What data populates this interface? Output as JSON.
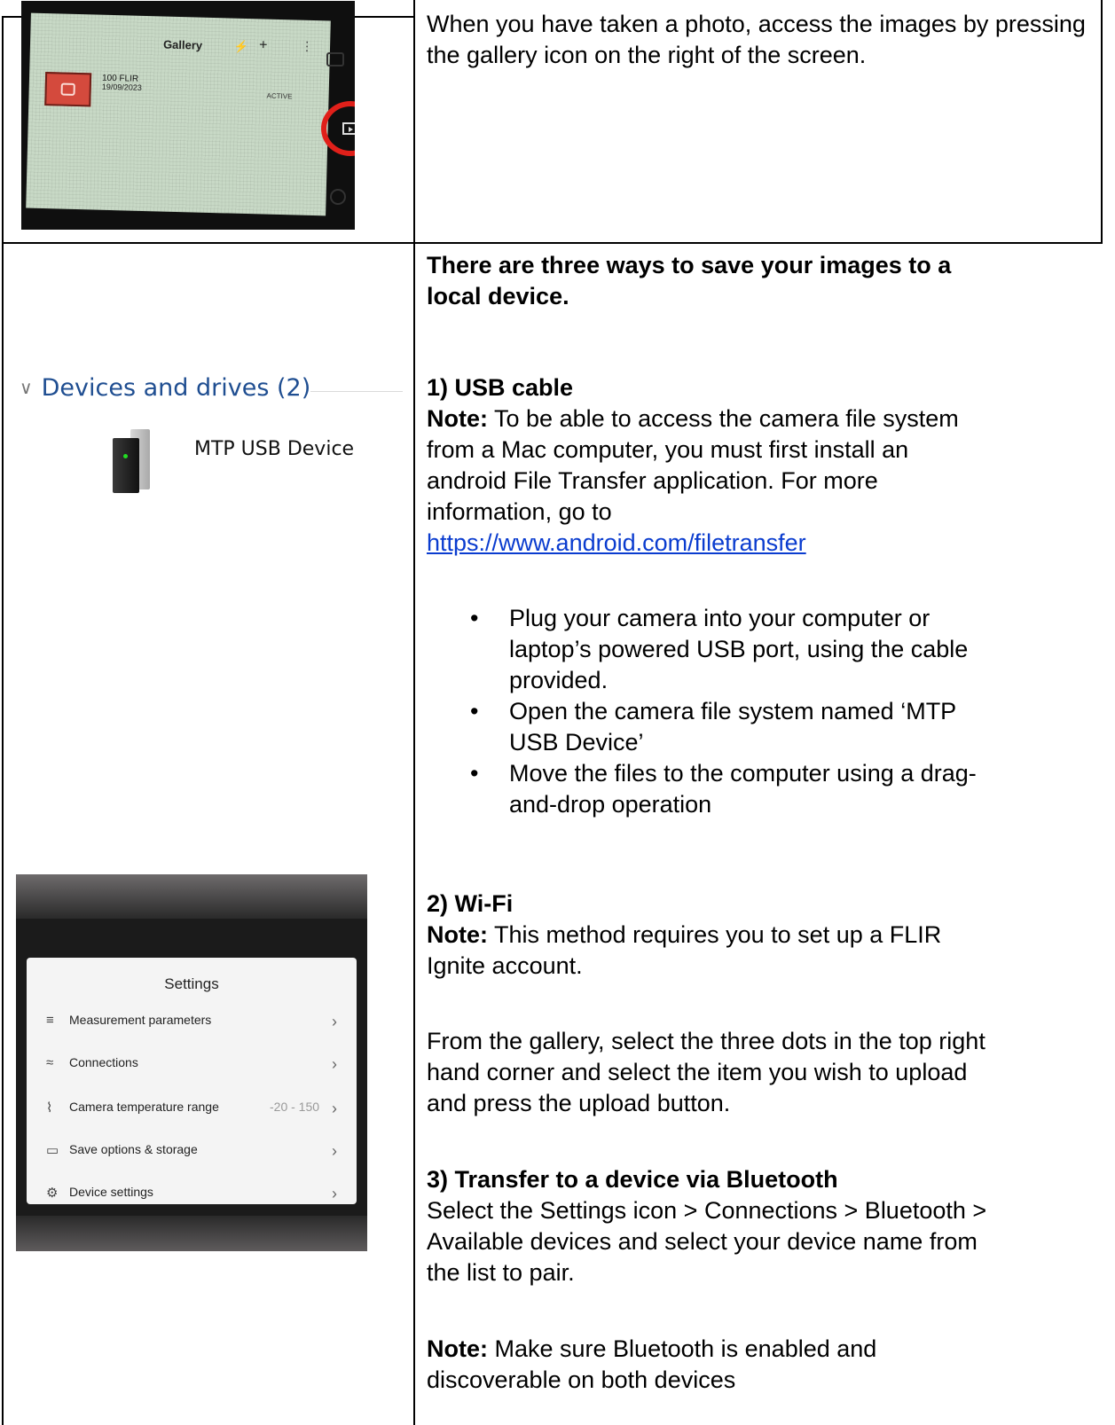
{
  "row1": {
    "intro": "When you have taken a photo, access the images by pressing the gallery icon on the right of the screen."
  },
  "gallery_photo": {
    "title": "Gallery",
    "bolt": "⚡",
    "plus": "+",
    "dots": "⋮",
    "folder_name": "100 FLIR",
    "folder_date": "19/09/2023",
    "status": "ACTIVE"
  },
  "explorer": {
    "chevron": "∨",
    "section_heading": "Devices and drives (2)",
    "drive_name": "MTP USB Device"
  },
  "settings_photo": {
    "title": "Settings",
    "rows": [
      {
        "icon": "≡",
        "label": "Measurement parameters",
        "value": "",
        "chev": "›"
      },
      {
        "icon": "≈",
        "label": "Connections",
        "value": "",
        "chev": "›"
      },
      {
        "icon": "⌇",
        "label": "Camera temperature range",
        "value": "-20 - 150",
        "chev": "›"
      },
      {
        "icon": "▭",
        "label": "Save options & storage",
        "value": "",
        "chev": "›"
      },
      {
        "icon": "⚙",
        "label": "Device settings",
        "value": "",
        "chev": "›"
      }
    ]
  },
  "main": {
    "heading_line1": "There are three ways to save your images to a",
    "heading_line2": "local device.",
    "usb": {
      "heading": "1) USB cable",
      "note_label": "Note:",
      "note_line1": " To be able to access the camera file system",
      "note_line2": "from a Mac computer, you must first install an",
      "note_line3": "android File Transfer application. For more",
      "note_line4": "information, go to",
      "link": "https://www.android.com/filetransfer",
      "bullets": [
        {
          "l1": "Plug your camera into your computer or",
          "l2": "laptop’s powered USB port, using the cable",
          "l3": "provided."
        },
        {
          "l1": "Open the camera file system named ‘MTP",
          "l2": "USB Device’",
          "l3": ""
        },
        {
          "l1": "Move the files to the computer using a drag-",
          "l2": "and-drop operation",
          "l3": ""
        }
      ]
    },
    "wifi": {
      "heading": "2) Wi-Fi",
      "note_label": "Note:",
      "note_line1": " This method requires you to set up a FLIR",
      "note_line2": "Ignite account.",
      "para_line1": "From the gallery, select the three dots in the top right",
      "para_line2": "hand corner and select the item you wish to upload",
      "para_line3": "and press the upload button."
    },
    "bluetooth": {
      "heading": "3) Transfer to a device via Bluetooth",
      "line1": "Select the Settings icon > Connections > Bluetooth >",
      "line2": "Available devices and select your device name from",
      "line3": "the list to pair.",
      "note_label": "Note:",
      "note_line1": " Make sure Bluetooth is enabled and",
      "note_line2": "discoverable on both devices"
    }
  },
  "colors": {
    "link": "#0a3ccf",
    "highlight_circle": "#e0201a",
    "explorer_heading": "#1f4e91"
  }
}
